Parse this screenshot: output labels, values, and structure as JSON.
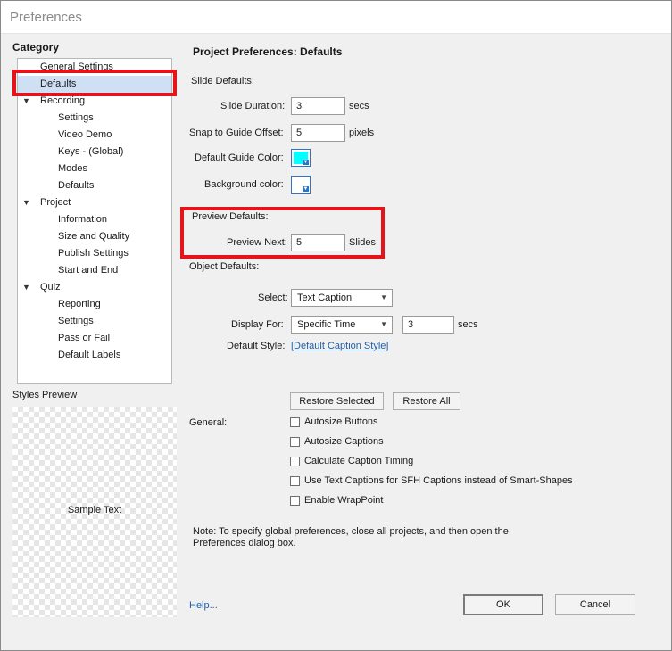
{
  "window": {
    "title": "Preferences"
  },
  "sidebar": {
    "heading": "Category",
    "items": [
      {
        "label": "General Settings",
        "level": 0,
        "caret": ""
      },
      {
        "label": "Defaults",
        "level": 0,
        "caret": "",
        "selected": true
      },
      {
        "label": "Recording",
        "level": 0,
        "caret": "▼"
      },
      {
        "label": "Settings",
        "level": 1,
        "caret": ""
      },
      {
        "label": "Video Demo",
        "level": 1,
        "caret": ""
      },
      {
        "label": "Keys - (Global)",
        "level": 1,
        "caret": ""
      },
      {
        "label": "Modes",
        "level": 1,
        "caret": ""
      },
      {
        "label": "Defaults",
        "level": 1,
        "caret": ""
      },
      {
        "label": "Project",
        "level": 0,
        "caret": "▼"
      },
      {
        "label": "Information",
        "level": 1,
        "caret": ""
      },
      {
        "label": "Size and Quality",
        "level": 1,
        "caret": ""
      },
      {
        "label": "Publish Settings",
        "level": 1,
        "caret": ""
      },
      {
        "label": "Start and End",
        "level": 1,
        "caret": ""
      },
      {
        "label": "Quiz",
        "level": 0,
        "caret": "▼"
      },
      {
        "label": "Reporting",
        "level": 1,
        "caret": ""
      },
      {
        "label": "Settings",
        "level": 1,
        "caret": ""
      },
      {
        "label": "Pass or Fail",
        "level": 1,
        "caret": ""
      },
      {
        "label": "Default Labels",
        "level": 1,
        "caret": ""
      }
    ]
  },
  "styles_preview": {
    "heading": "Styles Preview",
    "sample_text": "Sample Text"
  },
  "main": {
    "title": "Project Preferences: Defaults",
    "slide_defaults": {
      "heading": "Slide Defaults:",
      "slide_duration_label": "Slide Duration:",
      "slide_duration_value": "3",
      "slide_duration_unit": "secs",
      "snap_label": "Snap to Guide Offset:",
      "snap_value": "5",
      "snap_unit": "pixels",
      "guide_color_label": "Default Guide Color:",
      "guide_color": "#00ffff",
      "bg_color_label": "Background color:",
      "bg_color": "#ffffff"
    },
    "preview_defaults": {
      "heading": "Preview Defaults:",
      "preview_next_label": "Preview Next:",
      "preview_next_value": "5",
      "preview_next_unit": "Slides"
    },
    "object_defaults": {
      "heading": "Object Defaults:",
      "select_label": "Select:",
      "select_value": "Text Caption",
      "display_for_label": "Display For:",
      "display_for_value": "Specific Time",
      "display_time_value": "3",
      "display_time_unit": "secs",
      "default_style_label": "Default Style:",
      "default_style_link": "[Default Caption Style]"
    },
    "restore_selected_label": "Restore Selected",
    "restore_all_label": "Restore All",
    "general": {
      "heading": "General:",
      "checkboxes": [
        {
          "label": "Autosize Buttons",
          "checked": false
        },
        {
          "label": "Autosize Captions",
          "checked": false
        },
        {
          "label": "Calculate Caption Timing",
          "checked": false
        },
        {
          "label": "Use Text Captions for SFH Captions instead of Smart-Shapes",
          "checked": false
        },
        {
          "label": "Enable WrapPoint",
          "checked": false
        }
      ]
    },
    "note": "Note: To specify global preferences, close all projects, and then open the Preferences dialog box."
  },
  "footer": {
    "help_label": "Help...",
    "ok_label": "OK",
    "cancel_label": "Cancel"
  },
  "colors": {
    "highlight_box": "#e4151a",
    "link": "#1f5fa8",
    "selection": "#cfe0f5"
  }
}
